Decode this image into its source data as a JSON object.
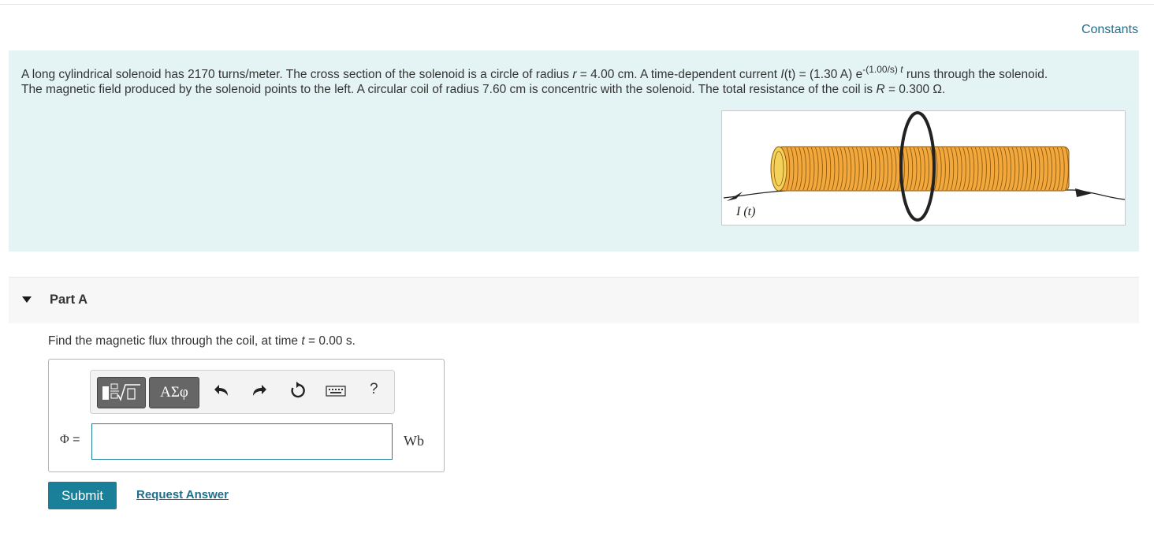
{
  "header": {
    "constants_link": "Constants"
  },
  "problem": {
    "line1": {
      "t1": "A long cylindrical solenoid has 2170 turns/meter. The cross section of the solenoid is a circle of radius ",
      "r_var": "r",
      "t2": " = 4.00 cm. A time-dependent current ",
      "I_var": "I",
      "t3": "(t) = (1.30 A) e",
      "exp_pre": "-(1.00/s) ",
      "exp_t": "t",
      "t4": " runs through the solenoid."
    },
    "line2": {
      "t1": "The magnetic field produced by the solenoid points to the left. A circular coil of radius 7.60 cm is concentric with the solenoid. The total resistance of the coil is ",
      "R_var": "R",
      "t2": " = 0.300 Ω."
    },
    "figure": {
      "current_label": "I (t)",
      "coil_color": "#f2a83c",
      "end_color": "#f4d25a"
    }
  },
  "part": {
    "title": "Part A",
    "question": {
      "t1": "Find the magnetic flux through the coil, at time ",
      "t_var": "t",
      "t2": " = 0.00 s."
    }
  },
  "answer": {
    "toolbar": {
      "templates_icon": "templates-icon",
      "greek_label": "ΑΣφ",
      "undo_icon": "undo-icon",
      "redo_icon": "redo-icon",
      "reset_icon": "reset-icon",
      "keyboard_icon": "keyboard-icon",
      "help_label": "?"
    },
    "symbol": "Φ",
    "equals": " =",
    "input_value": "",
    "unit": "Wb"
  },
  "actions": {
    "submit_label": "Submit",
    "request_answer_label": "Request Answer"
  },
  "colors": {
    "accent": "#1a7f99",
    "problem_bg": "#e4f4f5"
  }
}
